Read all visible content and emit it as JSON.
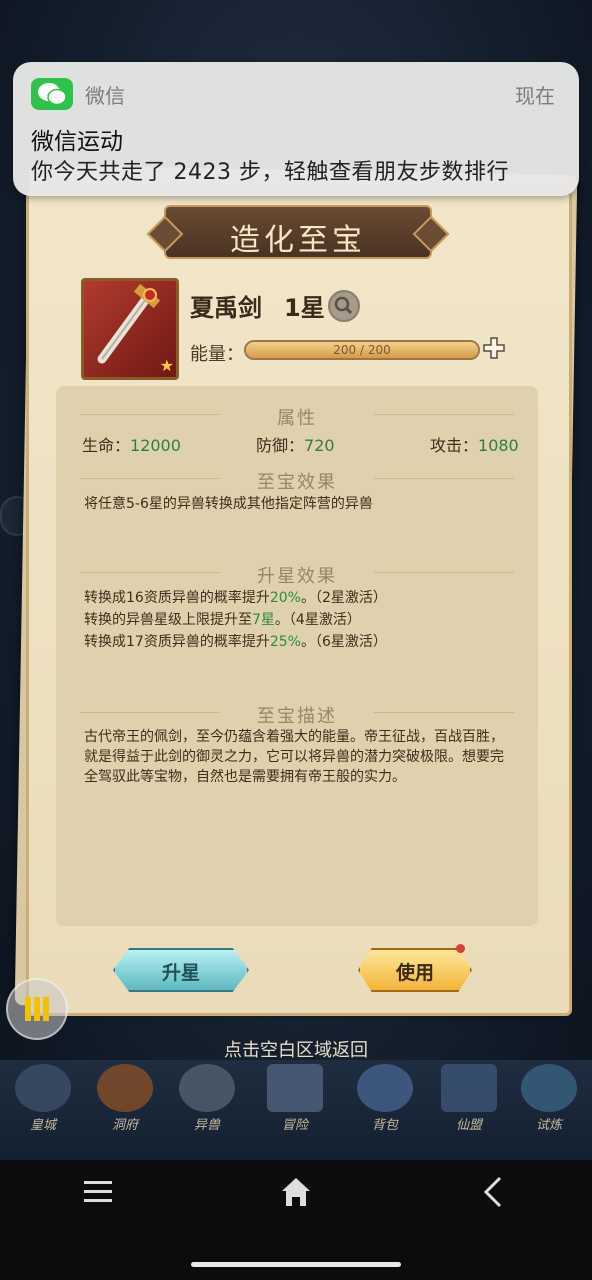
{
  "notification": {
    "app_name": "微信",
    "time": "现在",
    "title": "微信运动",
    "body": "你今天共走了 2423 步，轻触查看朋友步数排行",
    "icon": "wechat-icon"
  },
  "panel": {
    "title": "造化至宝",
    "item": {
      "name": "夏禹剑",
      "stars": "1星",
      "energy_label": "能量：",
      "energy_text": "200 / 200",
      "energy_fraction": 1.0
    },
    "attributes": {
      "heading": "属性",
      "hp_label": "生命：",
      "hp_value": "12000",
      "def_label": "防御：",
      "def_value": "720",
      "atk_label": "攻击：",
      "atk_value": "1080"
    },
    "treasure_effect": {
      "heading": "至宝效果",
      "text": "将任意5-6星的异兽转换成其他指定阵营的异兽"
    },
    "star_effect": {
      "heading": "升星效果",
      "lines": [
        {
          "pre": "转换成16资质异兽的概率提升",
          "hl": "20%",
          "post": "。（2星激活）"
        },
        {
          "pre": "转换的异兽星级上限提升至",
          "hl": "7星",
          "post": "。（4星激活）"
        },
        {
          "pre": "转换成17资质异兽的概率提升",
          "hl": "25%",
          "post": "。（6星激活）"
        }
      ]
    },
    "description": {
      "heading": "至宝描述",
      "text": "古代帝王的佩剑，至今仍蕴含着强大的能量。帝王征战，百战百胜，就是得益于此剑的御灵之力，它可以将异兽的潜力突破极限。想要完全驾驭此等宝物，自然也是需要拥有帝王般的实力。"
    },
    "buttons": {
      "upgrade": "升星",
      "use": "使用"
    }
  },
  "back_hint": "点击空白区域返回",
  "bottom_nav": [
    {
      "label": "皇城",
      "icon": "city-icon"
    },
    {
      "label": "洞府",
      "icon": "cave-icon"
    },
    {
      "label": "异兽",
      "icon": "beast-icon"
    },
    {
      "label": "冒险",
      "icon": "adventure-icon"
    },
    {
      "label": "背包",
      "icon": "bag-icon"
    },
    {
      "label": "仙盟",
      "icon": "alliance-icon"
    },
    {
      "label": "试炼",
      "icon": "trial-icon"
    }
  ],
  "system_nav": [
    "menu-icon",
    "home-icon",
    "back-icon"
  ],
  "colors": {
    "stat_green": "#2f7f3a",
    "parchment": "#f2e6c9",
    "wechat_green": "#2dc24a"
  }
}
